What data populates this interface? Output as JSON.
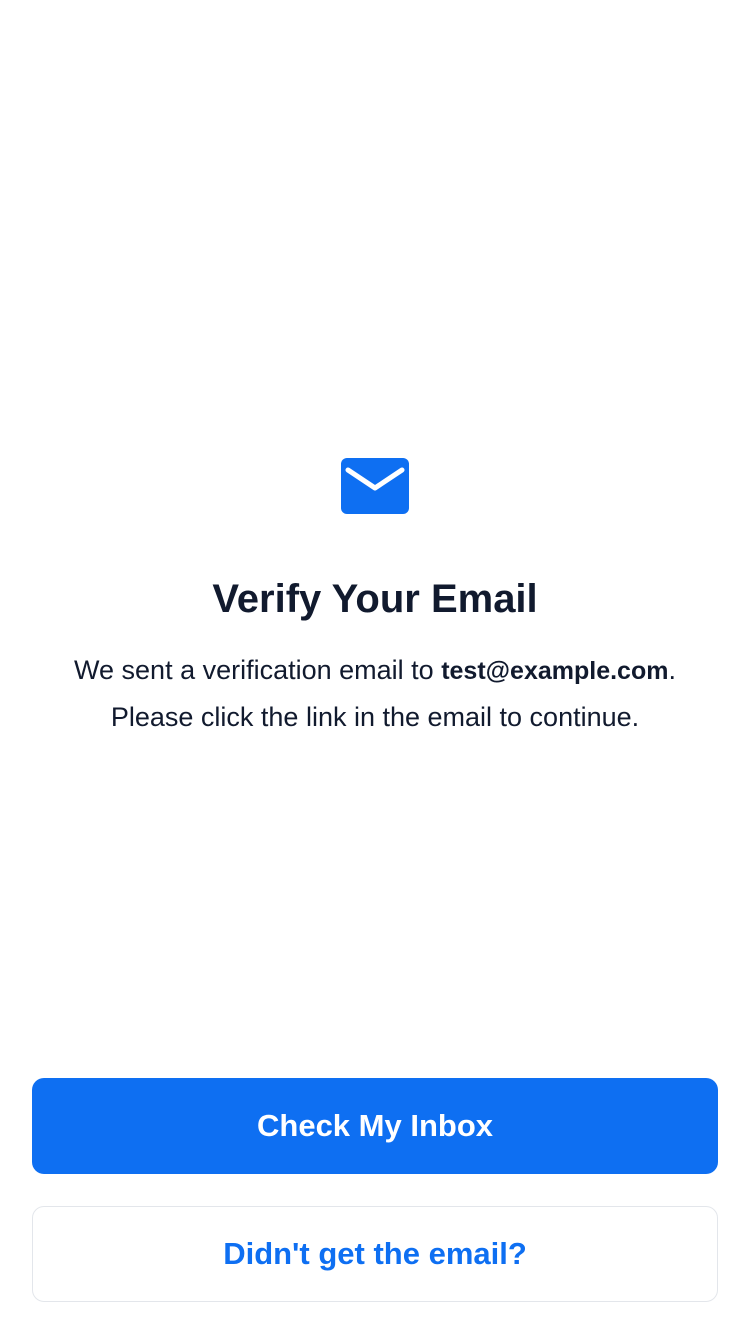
{
  "colors": {
    "accent": "#0e6ff2",
    "text": "#111a2e",
    "secondary_border": "#e3e6eb",
    "background": "#ffffff"
  },
  "header": {
    "icon": "mail-icon",
    "title": "Verify Your Email"
  },
  "message": {
    "prefix": "We sent a verification email to ",
    "email": "test@example.com",
    "suffix": ".",
    "line2": "Please click the link in the email to continue."
  },
  "actions": {
    "primary_label": "Check My Inbox",
    "secondary_label": "Didn't get the email?"
  }
}
